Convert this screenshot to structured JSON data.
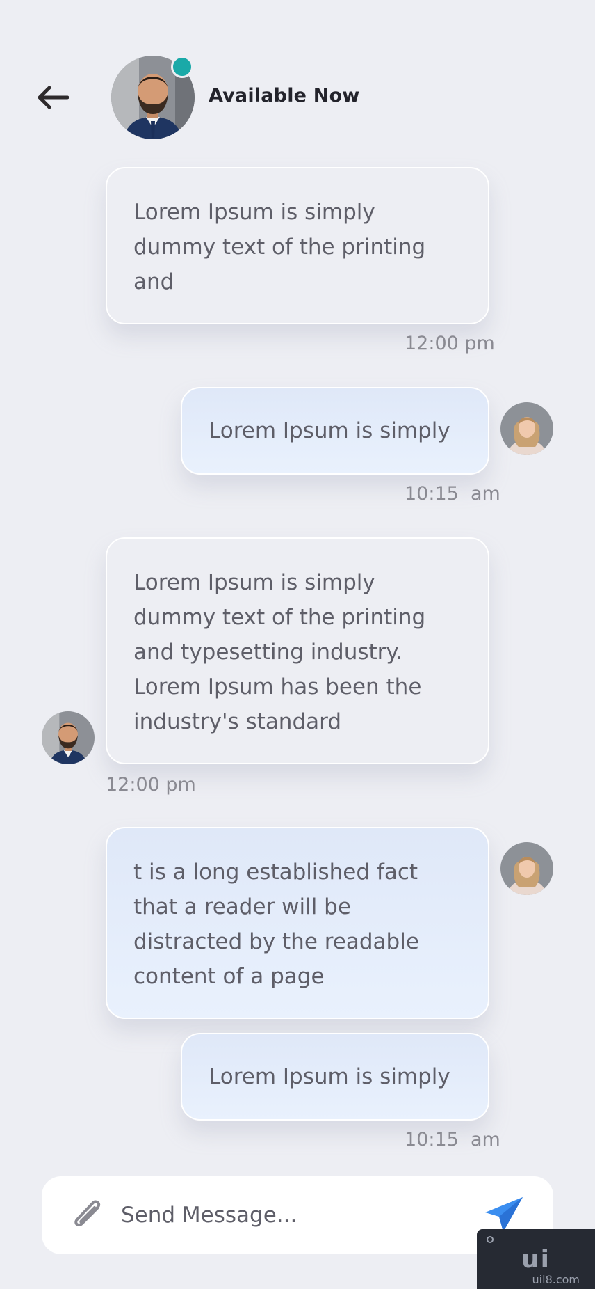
{
  "header": {
    "status": "Available Now",
    "contact_avatar_icon": "man-portrait",
    "online_color": "#1aa9a8"
  },
  "messages": [
    {
      "direction": "incoming",
      "text": "Lorem Ipsum is simply\ndummy text of the printing\nand",
      "time": "12:00 pm"
    },
    {
      "direction": "outgoing",
      "text": "Lorem Ipsum is simply",
      "time": "10:15  am"
    },
    {
      "direction": "incoming",
      "text": "Lorem Ipsum is simply\ndummy text of the printing\nand typesetting industry.\nLorem Ipsum has been the\nindustry's standard",
      "time": "12:00 pm"
    },
    {
      "direction": "outgoing",
      "text": "t is a long established fact\nthat a reader will be\ndistracted by the readable\ncontent of a page"
    },
    {
      "direction": "outgoing",
      "text": "Lorem Ipsum is simply",
      "time": "10:15  am"
    }
  ],
  "composer": {
    "placeholder": "Send Message...",
    "attach_icon": "paperclip-icon",
    "send_icon": "paper-plane-icon",
    "send_color": "#3b8ef0"
  },
  "watermark": {
    "text": "ui",
    "sub": "uil8.com"
  }
}
